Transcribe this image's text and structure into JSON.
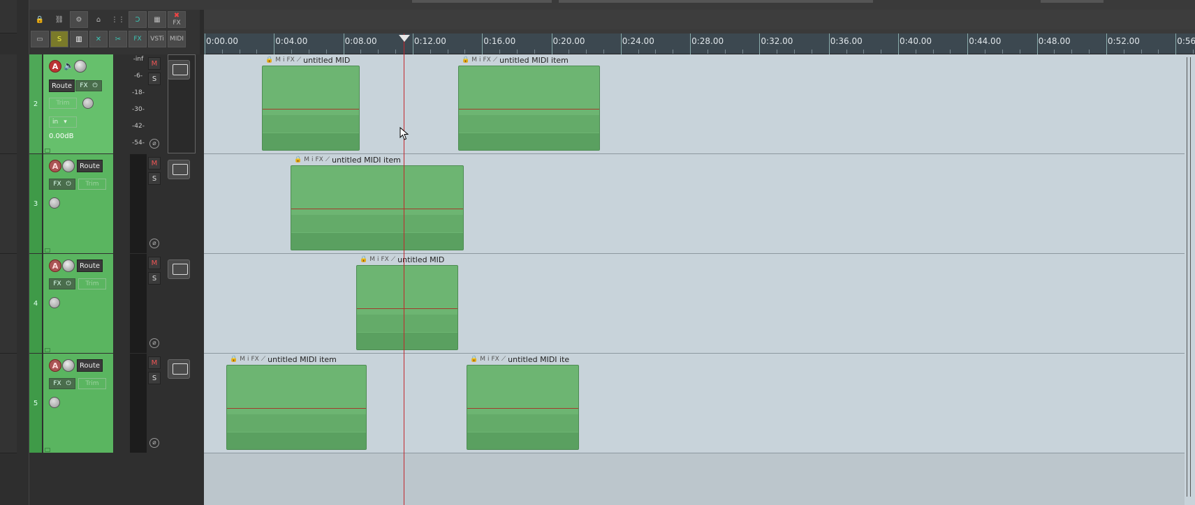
{
  "toolbar": {
    "fx_label": "FX",
    "vsti_label": "VSTi",
    "midi_label": "MIDI",
    "fx_teal_label": "FX",
    "solo_label": "S"
  },
  "ruler": {
    "labels": [
      "0:00.00",
      "0:04.00",
      "0:08.00",
      "0:12.00",
      "0:16.00",
      "0:20.00",
      "0:24.00",
      "0:28.00",
      "0:32.00",
      "0:36.00",
      "0:40.00",
      "0:44.00",
      "0:48.00",
      "0:52.00",
      "0:56"
    ]
  },
  "meter_labels": [
    "-inf",
    "-6-",
    "-18-",
    "-30-",
    "-42-",
    "-54-"
  ],
  "tracks": [
    {
      "number": "2",
      "arm": "A",
      "route": "Route",
      "fx": "FX",
      "trim": "Trim",
      "input": "in",
      "volume": "0.00dB",
      "mute": "M",
      "solo": "S"
    },
    {
      "number": "3",
      "arm": "A",
      "route": "Route",
      "fx": "FX",
      "trim": "Trim",
      "mute": "M",
      "solo": "S"
    },
    {
      "number": "4",
      "arm": "A",
      "route": "Route",
      "fx": "FX",
      "trim": "Trim",
      "mute": "M",
      "solo": "S"
    },
    {
      "number": "5",
      "arm": "A",
      "route": "Route",
      "fx": "FX",
      "trim": "Trim",
      "mute": "M",
      "solo": "S"
    }
  ],
  "items": [
    {
      "track": 0,
      "title": "untitled MID"
    },
    {
      "track": 0,
      "title": "untitled MIDI item"
    },
    {
      "track": 1,
      "title": "untitled MIDI item"
    },
    {
      "track": 2,
      "title": "untitled MID"
    },
    {
      "track": 3,
      "title": "untitled MIDI item"
    },
    {
      "track": 3,
      "title": "untitled MIDI ite"
    }
  ],
  "item_icons": [
    "lock-icon",
    "M",
    "i",
    "FX",
    "envelope-icon"
  ],
  "colors": {
    "track_green": "#5ab560",
    "item_green": "#6db572",
    "cursor_red": "#c1272d",
    "lane_bg": "#c8d3da"
  }
}
